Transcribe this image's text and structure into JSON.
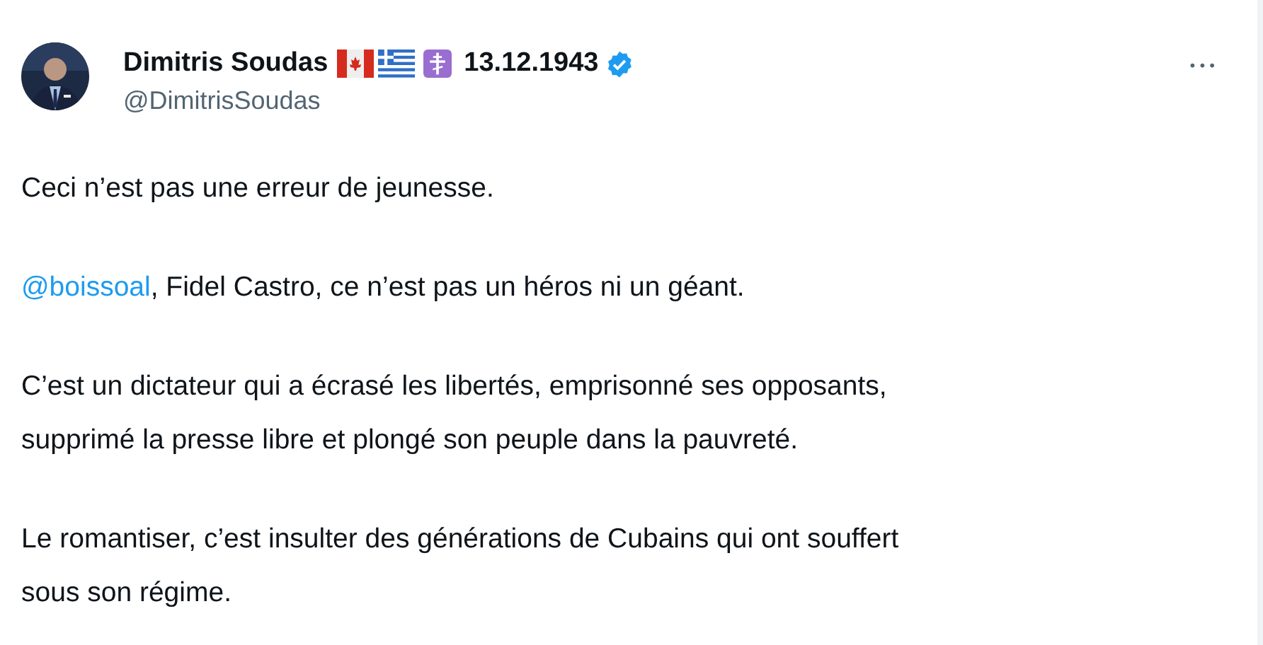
{
  "author": {
    "name": "Dimitris Soudas",
    "date": "13.12.1943",
    "verified": true,
    "handle": "@DimitrisSoudas"
  },
  "more": "•••",
  "paragraphs": [
    {
      "lines": [
        {
          "text": "Ceci n’est pas une erreur de jeunesse."
        }
      ]
    },
    {
      "lines": [
        {
          "mention": "@boissoal",
          "text": ", Fidel Castro, ce n’est pas un héros ni un géant."
        }
      ]
    },
    {
      "lines": [
        {
          "text": "C’est un dictateur qui a écrasé les libertés, emprisonné ses opposants,"
        },
        {
          "text": "supprimé la presse libre et plongé son peuple dans la pauvreté."
        }
      ]
    },
    {
      "lines": [
        {
          "text": "Le romantiser, c’est insulter des générations de Cubains qui ont souffert"
        },
        {
          "text": "sous son régime."
        }
      ]
    }
  ]
}
